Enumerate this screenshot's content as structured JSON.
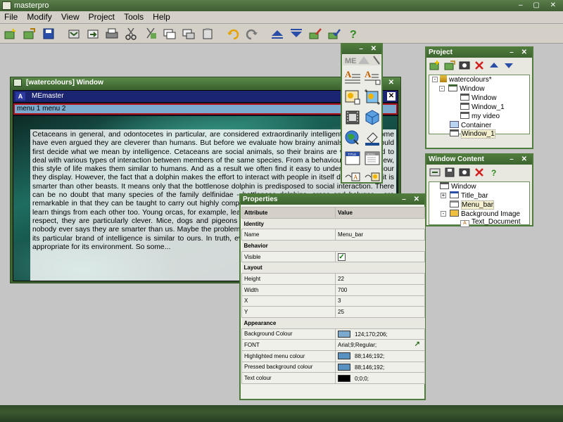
{
  "app": {
    "title": "masterpro"
  },
  "menubar": [
    "File",
    "Modify",
    "View",
    "Project",
    "Tools",
    "Help"
  ],
  "toolbar": [
    "new-project-icon",
    "open-project-icon",
    "save-icon",
    "import-icon",
    "export-icon",
    "print-icon",
    "cut-icon",
    "copy-icon",
    "duplicate-icon",
    "paste-icon",
    "clear-icon",
    "undo-icon",
    "redo-icon",
    "move-up-icon",
    "move-down-icon",
    "edit-icon",
    "check-icon",
    "help-icon"
  ],
  "window": {
    "title": "[watercolours] Window",
    "me_title": "MEmaster",
    "menu_items": "menu 1  menu 2",
    "body_text": "Cetaceans in general, and odontocetes in particular, are considered extraordinarily intelligent animals. Some have even argued they are cleverer than humans. But before we evaluate how brainy animals are, we should first decide what we mean by intelligence. Cetaceans are social animals, so their brains are well equipped to deal with various types of interaction between members of the same species. From a behavioural point of view, this style of life makes them similar to humans. And as a result we often find it easy to understand behaviour they display. However, the fact that a dolphin makes the effort to interact with people in itself doesn't mean it is smarter than other beasts. It means only that the bottlenose dolphin is predisposed to social interaction. There can be no doubt that many species of the family delfinidae - bottlenose dolphins, orcas and belugas - are remarkable in that they can be taught to carry out highly complex commands. These types of odontocete can learn things from each other too. Young orcas, for example, learn how to hunt by watching their elders. In that respect, they are particularly clever. Mice, dogs and pigeons can also be trained to do complex tasks, but nobody ever says they are smarter than us. Maybe the problem is that we tend to regard an animal as clever if its particular brand of intelligence is similar to ours. In truth, every species has the capabilities that are most appropriate for its environment. So some..."
  },
  "project": {
    "title": "Project",
    "tree": [
      {
        "label": "watercolours*",
        "depth": 0,
        "icon": "project"
      },
      {
        "label": "Window",
        "depth": 1,
        "icon": "window"
      },
      {
        "label": "Window",
        "depth": 2,
        "icon": "window"
      },
      {
        "label": "Window_1",
        "depth": 2,
        "icon": "window"
      },
      {
        "label": "my video",
        "depth": 2,
        "icon": "window"
      },
      {
        "label": "Container",
        "depth": 1,
        "icon": "container"
      },
      {
        "label": "Window_1",
        "depth": 1,
        "icon": "window",
        "selected": true
      }
    ]
  },
  "window_content": {
    "title": "Window Content",
    "tree": [
      {
        "label": "Window",
        "depth": 0
      },
      {
        "label": "Title_bar",
        "depth": 1
      },
      {
        "label": "Menu_bar",
        "depth": 1,
        "selected": true
      },
      {
        "label": "Background Image",
        "depth": 1
      },
      {
        "label": "Text_Document",
        "depth": 2
      }
    ]
  },
  "properties": {
    "title": "Properties",
    "col_attribute": "Attribute",
    "col_value": "Value",
    "rows": [
      {
        "section": "Identity"
      },
      {
        "attr": "Name",
        "value": "Menu_bar"
      },
      {
        "section": "Behavior"
      },
      {
        "attr": "Visible",
        "value": "",
        "checkbox": true
      },
      {
        "section": "Layout"
      },
      {
        "attr": "Height",
        "value": "22"
      },
      {
        "attr": "Width",
        "value": "700"
      },
      {
        "attr": "X",
        "value": "3"
      },
      {
        "attr": "Y",
        "value": "25"
      },
      {
        "section": "Appearance"
      },
      {
        "attr": "Background Colour",
        "value": "124;170;206;",
        "swatch": "#7caace"
      },
      {
        "attr": "FONT",
        "value": "Arial;9;Regular;",
        "arrow": true
      },
      {
        "attr": "Highlighted menu colour",
        "value": "88;146;192;",
        "swatch": "#5892c0"
      },
      {
        "attr": "Pressed background colour",
        "value": "88;146;192;",
        "swatch": "#5892c0"
      },
      {
        "attr": "Text colour",
        "value": "0;0;0;",
        "swatch": "#000000"
      }
    ]
  },
  "colors": {
    "panel_border": "#4f7b3c",
    "menu_bar_bg": "#7caace",
    "menu_bar_border": "#b0101a"
  }
}
